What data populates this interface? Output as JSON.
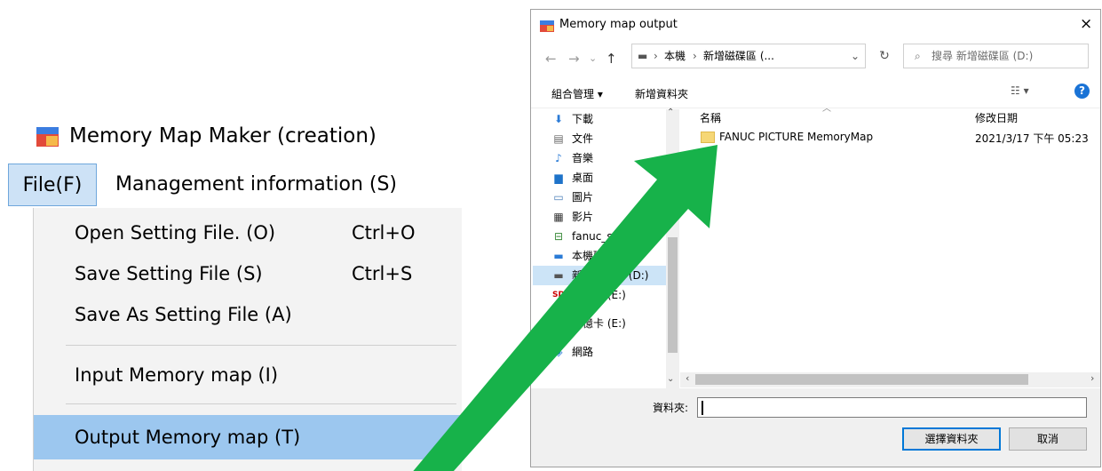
{
  "app": {
    "title": "Memory Map Maker (creation)",
    "menubar": {
      "file": "File(F)",
      "management": "Management information (S)"
    },
    "file_menu": [
      {
        "label": "Open Setting File. (O)",
        "shortcut": "Ctrl+O"
      },
      {
        "label": "Save Setting File (S)",
        "shortcut": "Ctrl+S"
      },
      {
        "label": "Save As Setting File (A)",
        "shortcut": ""
      },
      {
        "label": "Input Memory map (I)",
        "shortcut": ""
      },
      {
        "label": "Output Memory map (T)",
        "shortcut": ""
      }
    ]
  },
  "dialog": {
    "title": "Memory map output",
    "close": "×",
    "address": {
      "root": "本機",
      "drive": "新增磁碟區 (..."
    },
    "search_placeholder": "搜尋 新增磁碟區 (D:)",
    "toolbar": {
      "organize": "組合管理 ▾",
      "new_folder": "新增資料夾",
      "view": "☷ ▾",
      "help": "?"
    },
    "nav_items": [
      {
        "label": "下載",
        "icon": "download-icon"
      },
      {
        "label": "文件",
        "icon": "document-icon"
      },
      {
        "label": "音樂",
        "icon": "music-icon"
      },
      {
        "label": "桌面",
        "icon": "desktop-icon"
      },
      {
        "label": "圖片",
        "icon": "pictures-icon"
      },
      {
        "label": "影片",
        "icon": "videos-icon"
      },
      {
        "label": "fanuc_server (\\\\",
        "icon": "network-drive-icon"
      },
      {
        "label": "本機磁碟 (C:)",
        "icon": "drive-icon"
      },
      {
        "label": "新增磁碟區 (D:)",
        "icon": "drive-icon"
      },
      {
        "label": "記憶卡 (E:)",
        "icon": "sd-card-icon"
      },
      {
        "label": "記憶卡 (E:)",
        "icon": "sd-card-icon"
      },
      {
        "label": "網路",
        "icon": "network-icon"
      }
    ],
    "columns": {
      "name": "名稱",
      "date": "修改日期"
    },
    "files": [
      {
        "name": "FANUC PICTURE MemoryMap",
        "date": "2021/3/17 下午 05:23"
      }
    ],
    "folder_label": "資料夾:",
    "folder_value": "",
    "select_button": "選擇資料夾",
    "cancel_button": "取消"
  },
  "colors": {
    "arrow": "#17b24a",
    "menu_highlight": "#9cc7ef",
    "accent": "#0078d7"
  }
}
